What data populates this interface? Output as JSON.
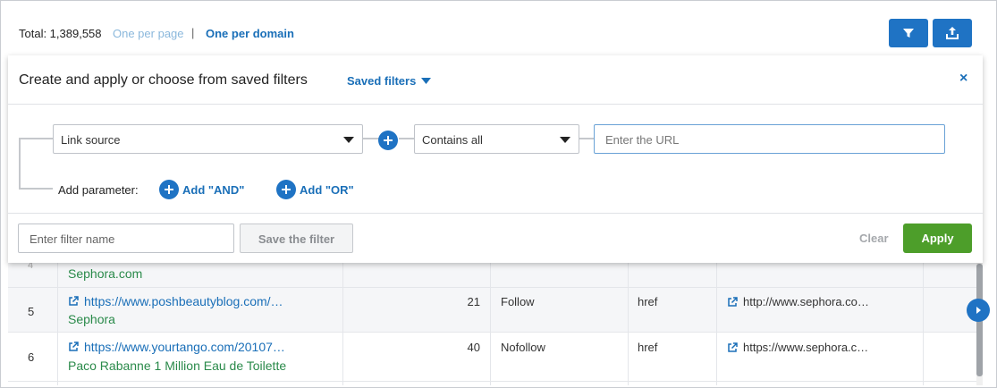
{
  "topbar": {
    "total_label": "Total: 1,389,558",
    "one_per_page": "One per page",
    "separator": "|",
    "one_per_domain": "One per domain",
    "filter_button_icon": "filter-icon",
    "export_button_icon": "export-icon"
  },
  "filter_panel": {
    "title": "Create and apply or choose from saved filters",
    "saved_filters": "Saved filters",
    "close": "×",
    "field_select": "Link source",
    "condition_select": "Contains all",
    "url_placeholder": "Enter the URL",
    "add_parameter_label": "Add parameter:",
    "add_and": "Add \"AND\"",
    "add_or": "Add \"OR\"",
    "filter_name_placeholder": "Enter filter name",
    "save_filter": "Save the filter",
    "clear": "Clear",
    "apply": "Apply",
    "colors": {
      "accent": "#1f73c4",
      "apply": "#4d9e2a"
    }
  },
  "table": {
    "rows": [
      {
        "num": "4",
        "url": "",
        "anchor": "Sephora.com",
        "count": "",
        "follow": "",
        "attr": "",
        "target": ""
      },
      {
        "num": "5",
        "url": "https://www.poshbeautyblog.com/…",
        "anchor": "Sephora",
        "count": "21",
        "follow": "Follow",
        "attr": "href",
        "target": "http://www.sephora.co…"
      },
      {
        "num": "6",
        "url": "https://www.yourtango.com/20107…",
        "anchor": "Paco Rabanne 1 Million Eau de Toilette",
        "count": "40",
        "follow": "Nofollow",
        "attr": "href",
        "target": "https://www.sephora.c…"
      }
    ]
  }
}
